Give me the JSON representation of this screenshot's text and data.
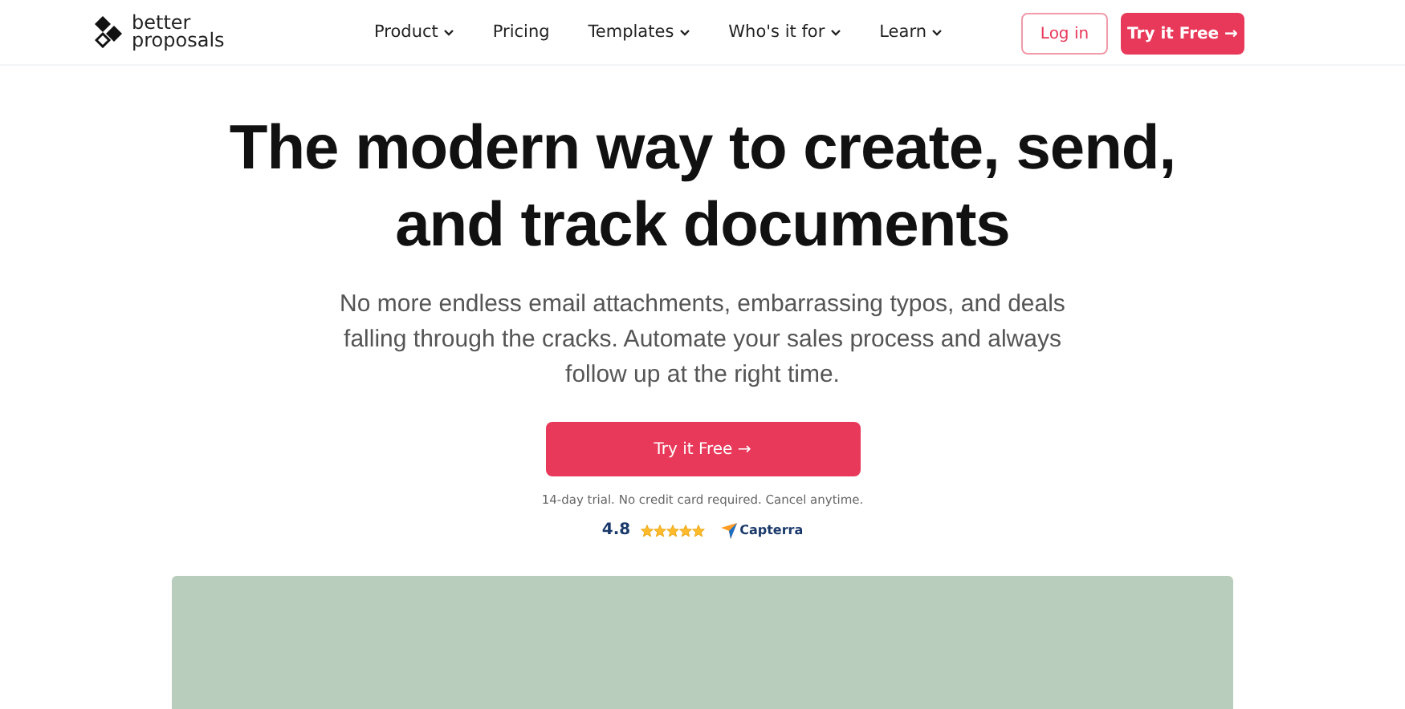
{
  "logo": {
    "line_1": "better",
    "line_2": "proposals"
  },
  "nav": [
    {
      "label": "Product",
      "kind": "dropdown"
    },
    {
      "label": "Pricing",
      "kind": "link"
    },
    {
      "label": "Templates",
      "kind": "dropdown"
    },
    {
      "label": "Who's it for",
      "kind": "dropdown"
    },
    {
      "label": "Learn",
      "kind": "dropdown"
    }
  ],
  "login_button": "Log in",
  "header_cta": "Try it Free →",
  "hero": {
    "title": "The modern way to create, send, and track documents",
    "subtitle": "No more endless email attachments, embarrassing typos, and deals falling through the cracks. Automate your sales process and always follow up at the right time.",
    "cta": "Try it Free →",
    "note": "14-day trial. No credit card required. Cancel anytime.",
    "rating": "4.8",
    "stars": 5,
    "review_site": "Capterra"
  }
}
